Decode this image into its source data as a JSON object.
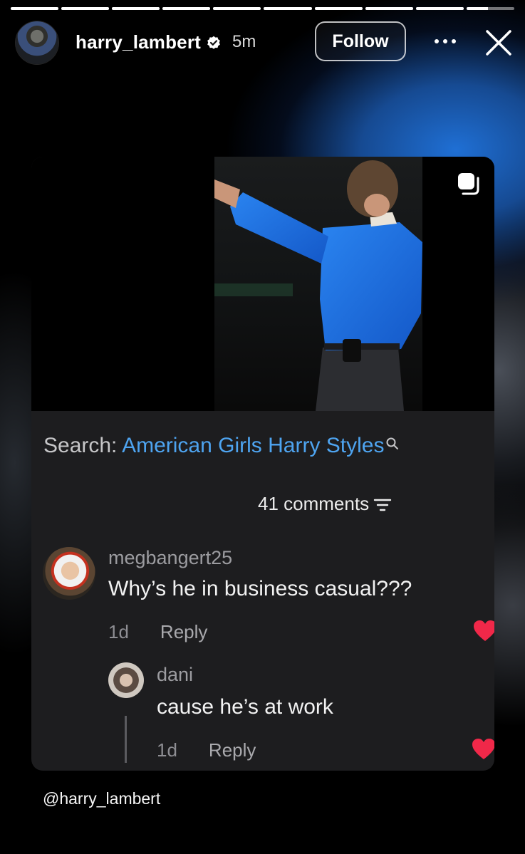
{
  "story": {
    "segments": 10,
    "active_segment": 9,
    "active_progress": 0.45
  },
  "header": {
    "username": "harry_lambert",
    "verified_icon": "verified-badge-icon",
    "time": "5m",
    "follow_label": "Follow",
    "more_icon": "more-dots-icon",
    "close_icon": "close-icon"
  },
  "post": {
    "copy_icon": "copy-icon",
    "search_label": "Search:",
    "search_query": "American Girls Harry Styles",
    "comments_count": "41 comments",
    "comments": [
      {
        "username": "megbangert25",
        "text": "Why’s he in business casual???",
        "age": "1d",
        "reply_label": "Reply",
        "liked": true
      },
      {
        "username": "dani",
        "text": "cause he’s at work",
        "age": "1d",
        "reply_label": "Reply",
        "liked": true
      }
    ]
  },
  "mention": "@harry_lambert",
  "colors": {
    "search_query": "#4ea4f0",
    "heart": "#f02849",
    "shirt": "#1f6fd4"
  }
}
